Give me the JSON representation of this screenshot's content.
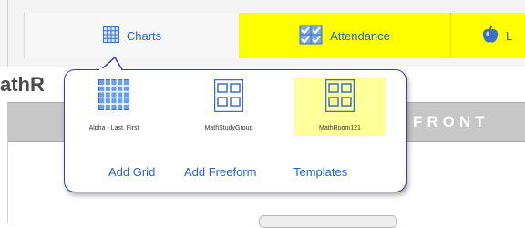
{
  "tabs": [
    {
      "label": "Charts",
      "icon": "grid-icon"
    },
    {
      "label": "Attendance",
      "icon": "attendance-check-icon"
    },
    {
      "label": "L",
      "icon": "apple-icon"
    }
  ],
  "room": {
    "title": "athR",
    "front_label": "FRONT"
  },
  "popup": {
    "charts": [
      {
        "label": "Alpha - Last, First",
        "icon": "alpha-grid-icon"
      },
      {
        "label": "MathStudyGroup",
        "icon": "freeform-icon"
      },
      {
        "label": "MathRoom121",
        "icon": "freeform-icon",
        "selected": true
      }
    ],
    "links": {
      "add_grid": "Add Grid",
      "add_freeform": "Add Freeform",
      "templates": "Templates"
    }
  },
  "colors": {
    "accent": "#2a62c9",
    "tab_highlight": "#ffff00",
    "selected": "#ffff99",
    "popup_border": "#3a3fa0",
    "front_bar": "#c7c7c7"
  }
}
